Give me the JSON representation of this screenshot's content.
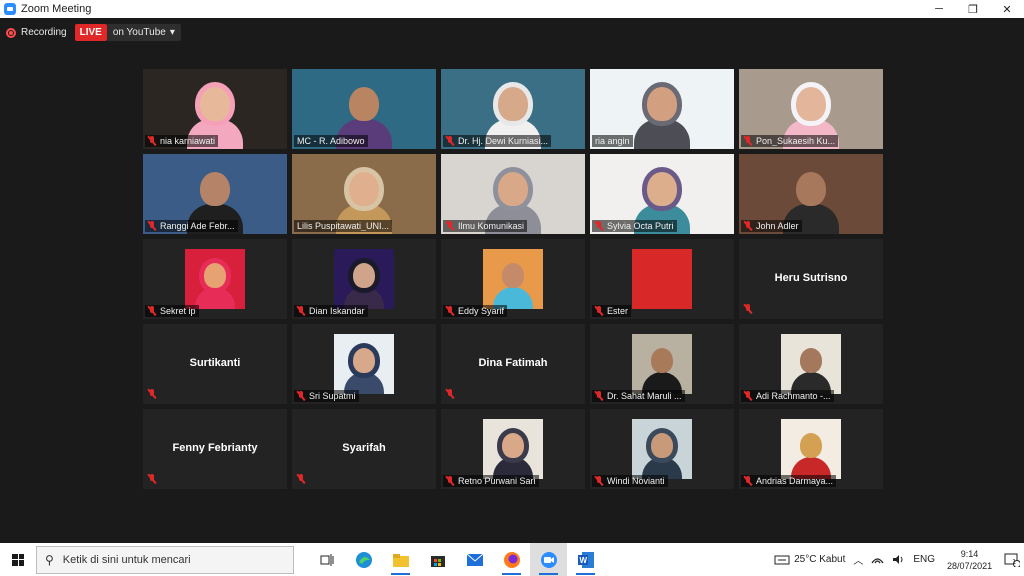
{
  "window": {
    "title": "Zoom Meeting",
    "controls": [
      "─",
      "❐",
      "✕"
    ]
  },
  "recording": {
    "label": "Recording",
    "live_badge": "LIVE",
    "stream_target": "on YouTube",
    "dropdown_caret": "▾"
  },
  "participants": [
    {
      "name": "nia karniawati",
      "type": "video",
      "muted": true,
      "bg": "#2c2623",
      "skin": "#e8b89a",
      "cloth": "#f3a8c0",
      "hijab": "#f4a0b8"
    },
    {
      "name": "MC - R. Adibowo",
      "type": "video",
      "muted": false,
      "active": true,
      "bg": "#2f6a85",
      "skin": "#b88462",
      "cloth": "#5a3c7a",
      "hijab": ""
    },
    {
      "name": "Dr. Hj. Dewi Kurniasi...",
      "type": "video",
      "muted": true,
      "bg": "#3a6f86",
      "skin": "#d6a98a",
      "cloth": "#f0f0f0",
      "hijab": "#e8e8e8"
    },
    {
      "name": "ria angin",
      "type": "video",
      "muted": false,
      "bg": "#eef3f6",
      "skin": "#d2a080",
      "cloth": "#4d4d56",
      "hijab": "#6a6a74"
    },
    {
      "name": "Pon_Sukaesih Ku...",
      "type": "video",
      "muted": true,
      "bg": "#a89a8c",
      "skin": "#e3b59a",
      "cloth": "#f2b8c8",
      "hijab": "#f4f4f8"
    },
    {
      "name": "Ranggi Ade Febr...",
      "type": "video",
      "muted": true,
      "bg": "#3a5c86",
      "skin": "#b58468",
      "cloth": "#1f1f1f",
      "hijab": ""
    },
    {
      "name": "Lilis Puspitawati_UNI...",
      "type": "video",
      "muted": false,
      "bg": "#8a6c4a",
      "skin": "#e0b08e",
      "cloth": "#c4985a",
      "hijab": "#d6c4a4"
    },
    {
      "name": "Ilmu Komunikasi",
      "type": "video",
      "muted": true,
      "bg": "#d8d4d0",
      "skin": "#d9a888",
      "cloth": "#8e8e98",
      "hijab": "#8e909c"
    },
    {
      "name": "Sylvia Octa Putri",
      "type": "video",
      "muted": true,
      "bg": "#f2f0ee",
      "skin": "#dcae8c",
      "cloth": "#3c8c9c",
      "hijab": "#6a5a8a"
    },
    {
      "name": "John Adler",
      "type": "video",
      "muted": true,
      "bg": "#6c4a3a",
      "skin": "#a8785c",
      "cloth": "#2a2a2a",
      "hijab": ""
    },
    {
      "name": "Sekret ip",
      "type": "photo",
      "muted": true,
      "bg": "#d8203c",
      "skin": "#e6a272",
      "cloth": "#e82c58",
      "hijab": "#e82c58"
    },
    {
      "name": "Dian Iskandar",
      "type": "photo",
      "muted": true,
      "bg": "#2a1a5a",
      "skin": "#d0a48a",
      "cloth": "#3a2a4a",
      "hijab": "#1a1a2a"
    },
    {
      "name": "Eddy Syarif",
      "type": "photo",
      "muted": true,
      "bg": "#e89a4a",
      "skin": "#c48a6a",
      "cloth": "#4ab8d8",
      "hijab": ""
    },
    {
      "name": "Ester",
      "type": "photo",
      "muted": true,
      "bg": "#d82828",
      "skin": "",
      "cloth": "",
      "hijab": ""
    },
    {
      "name": "Heru Sutrisno",
      "type": "name",
      "muted": true
    },
    {
      "name": "Surtikanti",
      "type": "name",
      "muted": true
    },
    {
      "name": "Sri Supatmi",
      "type": "photo",
      "muted": true,
      "bg": "#e8eef2",
      "skin": "#d8a88a",
      "cloth": "#3a4a6a",
      "hijab": "#2a3a5a"
    },
    {
      "name": "Dina Fatimah",
      "type": "name",
      "muted": true
    },
    {
      "name": "Dr. Sahat Maruli ...",
      "type": "photo",
      "muted": true,
      "bg": "#b8b0a0",
      "skin": "#a87a5a",
      "cloth": "#1a1a1a",
      "hijab": ""
    },
    {
      "name": "Adi Rachmanto -...",
      "type": "photo",
      "muted": true,
      "bg": "#e8e4da",
      "skin": "#a4785c",
      "cloth": "#2a2a2a",
      "hijab": ""
    },
    {
      "name": "Fenny Febrianty",
      "type": "name",
      "muted": true
    },
    {
      "name": "Syarifah",
      "type": "name",
      "muted": true
    },
    {
      "name": "Retno Purwani Sari",
      "type": "photo",
      "muted": true,
      "bg": "#e8e4dc",
      "skin": "#d8a888",
      "cloth": "#2a2a3a",
      "hijab": "#3a3a4a"
    },
    {
      "name": "Windi Novianti",
      "type": "photo",
      "muted": true,
      "bg": "#c8d4d8",
      "skin": "#c89a7a",
      "cloth": "#2a3a4a",
      "hijab": "#3a4a5a"
    },
    {
      "name": "Andrias Darmaya...",
      "type": "photo",
      "muted": true,
      "bg": "#f2ece2",
      "skin": "#d4a052",
      "cloth": "#c82828",
      "hijab": ""
    }
  ],
  "taskbar": {
    "search_placeholder": "Ketik di sini untuk mencari",
    "apps": [
      {
        "icon": "task-view-icon",
        "state": "none"
      },
      {
        "icon": "edge-icon",
        "state": "none"
      },
      {
        "icon": "file-explorer-icon",
        "state": "open"
      },
      {
        "icon": "store-icon",
        "state": "none"
      },
      {
        "icon": "mail-icon",
        "state": "none"
      },
      {
        "icon": "firefox-icon",
        "state": "open"
      },
      {
        "icon": "zoom-icon",
        "state": "active"
      },
      {
        "icon": "word-icon",
        "state": "open"
      }
    ],
    "weather": "25°C  Kabut",
    "language": "ENG",
    "time": "9:14",
    "date": "28/07/2021",
    "notifications": "1"
  },
  "colors": {
    "zoom_blue": "#2d8cff",
    "live_red": "#e02828",
    "active_speaker": "#d9e645",
    "muted_red": "#e02828"
  }
}
